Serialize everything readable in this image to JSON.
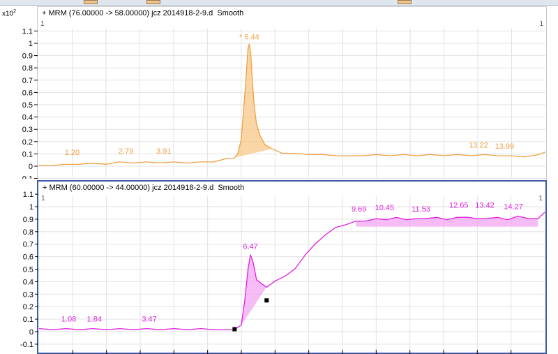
{
  "toolbar": {
    "buttons": [
      "toolbar-button-1",
      "toolbar-button-2",
      "toolbar-button-3"
    ]
  },
  "chart_data": [
    {
      "type": "line",
      "title": "+ MRM (76.00000 -> 58.00000) jcz 2014918-2-9.d  Smooth",
      "scale_label": "x10",
      "scale_exp": "2",
      "corner_left": "1",
      "corner_right": "1",
      "color": "#f0a040",
      "fill": "#f8c88a",
      "ylim": [
        -0.1,
        1.1
      ],
      "xlim": [
        0.2,
        15.2
      ],
      "yticks": [
        "1.1",
        "1",
        "0.9",
        "0.8",
        "0.7",
        "0.6",
        "0.5",
        "0.4",
        "0.3",
        "0.2",
        "0.1",
        "0",
        "-0.1"
      ],
      "x": [
        0.2,
        0.6,
        1.0,
        1.4,
        1.8,
        2.2,
        2.6,
        3.0,
        3.4,
        3.8,
        4.2,
        4.6,
        5.0,
        5.4,
        5.8,
        6.0,
        6.1,
        6.2,
        6.3,
        6.35,
        6.4,
        6.44,
        6.48,
        6.52,
        6.58,
        6.65,
        6.75,
        6.9,
        7.1,
        7.4,
        7.8,
        8.2,
        8.6,
        9.0,
        9.4,
        9.8,
        10.2,
        10.6,
        11.0,
        11.4,
        11.8,
        12.2,
        12.6,
        13.0,
        13.4,
        13.8,
        14.2,
        14.6,
        15.0,
        15.2
      ],
      "y": [
        0.0,
        0.01,
        0.01,
        0.02,
        0.02,
        0.02,
        0.03,
        0.03,
        0.03,
        0.03,
        0.03,
        0.03,
        0.03,
        0.04,
        0.06,
        0.07,
        0.1,
        0.22,
        0.55,
        0.75,
        0.95,
        1.0,
        0.92,
        0.75,
        0.5,
        0.35,
        0.25,
        0.18,
        0.14,
        0.11,
        0.1,
        0.1,
        0.09,
        0.09,
        0.08,
        0.09,
        0.09,
        0.09,
        0.09,
        0.09,
        0.09,
        0.09,
        0.09,
        0.09,
        0.09,
        0.09,
        0.08,
        0.08,
        0.09,
        0.12
      ],
      "peaks": [
        {
          "label": "1.20",
          "x": 1.2,
          "y": 0.08
        },
        {
          "label": "2.79",
          "x": 2.79,
          "y": 0.09
        },
        {
          "label": "3.91",
          "x": 3.91,
          "y": 0.09
        },
        {
          "label": "* 6.44",
          "x": 6.44,
          "y": 1.02
        },
        {
          "label": "13.22",
          "x": 13.22,
          "y": 0.14
        },
        {
          "label": "13.99",
          "x": 13.99,
          "y": 0.13
        }
      ],
      "shaded_peak": {
        "x_start": 5.9,
        "x_end": 7.3
      }
    },
    {
      "type": "line",
      "title": "+ MRM (60.00000 -> 44.00000) jcz 2014918-2-9.d  Smooth",
      "scale_label": "x10",
      "scale_exp": "2",
      "corner_left": "1",
      "corner_right": "1",
      "color": "#e020e0",
      "fill": "#f3a6f3",
      "ylim": [
        -0.1,
        1.1
      ],
      "xlim": [
        0.2,
        15.2
      ],
      "yticks": [
        "1.1",
        "1",
        "0.9",
        "0.8",
        "0.7",
        "0.6",
        "0.5",
        "0.4",
        "0.3",
        "0.2",
        "0.1",
        "0",
        "-0.1"
      ],
      "x": [
        0.2,
        0.6,
        1.0,
        1.4,
        1.8,
        2.2,
        2.6,
        3.0,
        3.4,
        3.8,
        4.2,
        4.6,
        5.0,
        5.4,
        5.8,
        6.0,
        6.2,
        6.3,
        6.4,
        6.47,
        6.55,
        6.65,
        6.8,
        6.95,
        7.2,
        7.5,
        7.8,
        8.1,
        8.4,
        8.7,
        9.0,
        9.3,
        9.6,
        9.9,
        10.2,
        10.5,
        10.8,
        11.1,
        11.4,
        11.7,
        12.0,
        12.3,
        12.6,
        12.9,
        13.2,
        13.5,
        13.8,
        14.1,
        14.4,
        14.7,
        15.0,
        15.2
      ],
      "y": [
        0.02,
        0.02,
        0.02,
        0.02,
        0.02,
        0.02,
        0.02,
        0.02,
        0.02,
        0.02,
        0.02,
        0.02,
        0.02,
        0.02,
        0.01,
        0.02,
        0.05,
        0.25,
        0.5,
        0.62,
        0.55,
        0.42,
        0.38,
        0.36,
        0.4,
        0.45,
        0.5,
        0.62,
        0.7,
        0.78,
        0.83,
        0.86,
        0.88,
        0.89,
        0.9,
        0.9,
        0.91,
        0.9,
        0.9,
        0.91,
        0.91,
        0.9,
        0.91,
        0.92,
        0.9,
        0.91,
        0.91,
        0.9,
        0.92,
        0.91,
        0.9,
        0.96
      ],
      "peaks": [
        {
          "label": "1.08",
          "x": 1.08,
          "y": 0.07
        },
        {
          "label": "1.84",
          "x": 1.84,
          "y": 0.07
        },
        {
          "label": "3.47",
          "x": 3.47,
          "y": 0.07
        },
        {
          "label": "6.47",
          "x": 6.47,
          "y": 0.65
        },
        {
          "label": "9.69",
          "x": 9.69,
          "y": 0.95
        },
        {
          "label": "10.45",
          "x": 10.45,
          "y": 0.96
        },
        {
          "label": "11.53",
          "x": 11.53,
          "y": 0.95
        },
        {
          "label": "12.65",
          "x": 12.65,
          "y": 0.98
        },
        {
          "label": "13.42",
          "x": 13.42,
          "y": 0.98
        },
        {
          "label": "14.27",
          "x": 14.27,
          "y": 0.97
        }
      ],
      "shaded_peak": {
        "x_start": 6.15,
        "x_end": 6.95
      },
      "baseline_markers": [
        {
          "x": 6.0,
          "y": 0.02
        },
        {
          "x": 6.95,
          "y": 0.25
        }
      ],
      "shaded_band": {
        "x_start": 9.5,
        "x_end": 15.0,
        "y_floor": 0.84
      }
    }
  ]
}
